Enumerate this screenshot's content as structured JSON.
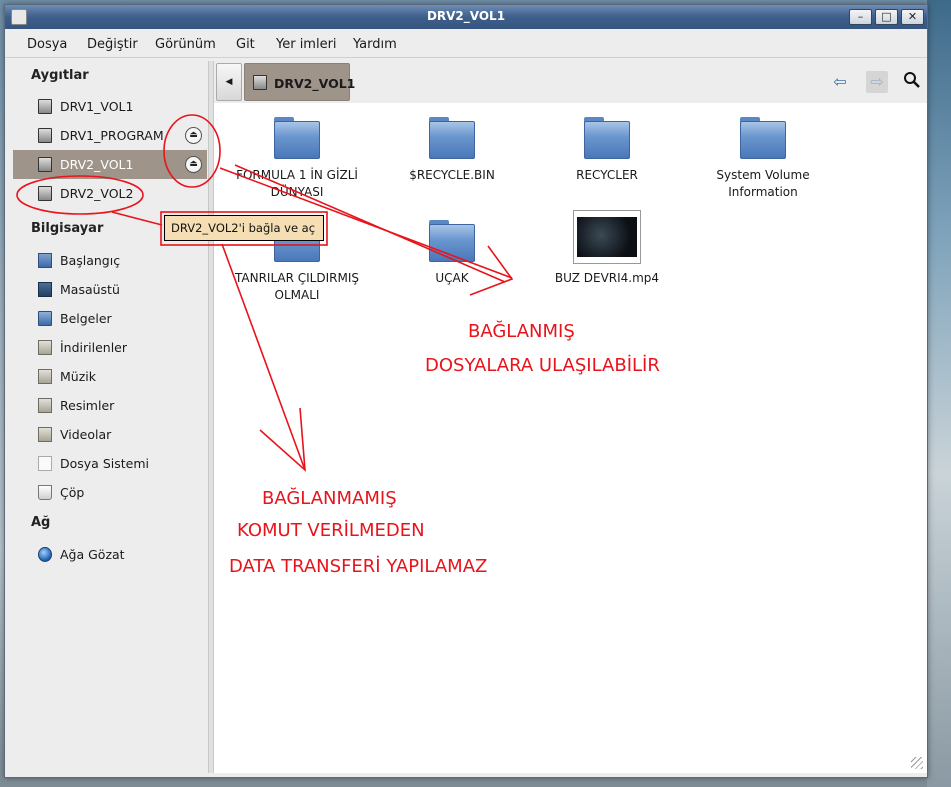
{
  "window": {
    "title": "DRV2_VOL1"
  },
  "menu": {
    "items": [
      {
        "label": "Dosya"
      },
      {
        "label": "Değiştir"
      },
      {
        "label": "Görünüm"
      },
      {
        "label": "Git"
      },
      {
        "label": "Yer imleri"
      },
      {
        "label": "Yardım"
      }
    ]
  },
  "sidebar": {
    "devices_heading": "Aygıtlar",
    "devices": [
      {
        "label": "DRV1_VOL1",
        "icon": "drive-icon",
        "eject": false,
        "selected": false
      },
      {
        "label": "DRV1_PROGRAM",
        "icon": "drive-icon",
        "eject": true,
        "selected": false
      },
      {
        "label": "DRV2_VOL1",
        "icon": "drive-icon",
        "eject": true,
        "selected": true
      },
      {
        "label": "DRV2_VOL2",
        "icon": "drive-icon",
        "eject": false,
        "selected": false
      }
    ],
    "computer_heading": "Bilgisayar",
    "computer": [
      {
        "label": "Başlangıç",
        "icon": "home-folder-icon"
      },
      {
        "label": "Masaüstü",
        "icon": "desktop-folder-icon"
      },
      {
        "label": "Belgeler",
        "icon": "documents-folder-icon"
      },
      {
        "label": "İndirilenler",
        "icon": "downloads-folder-icon"
      },
      {
        "label": "Müzik",
        "icon": "music-folder-icon"
      },
      {
        "label": "Resimler",
        "icon": "pictures-folder-icon"
      },
      {
        "label": "Videolar",
        "icon": "videos-folder-icon"
      },
      {
        "label": "Dosya Sistemi",
        "icon": "filesystem-icon"
      },
      {
        "label": "Çöp",
        "icon": "trash-icon"
      }
    ],
    "network_heading": "Ağ",
    "network": [
      {
        "label": "Ağa Gözat",
        "icon": "network-globe-icon"
      }
    ]
  },
  "pathbar": {
    "current": "DRV2_VOL1"
  },
  "files": [
    {
      "name": "FORMULA 1 İN GİZLİ DÜNYASI",
      "type": "folder"
    },
    {
      "name": "$RECYCLE.BIN",
      "type": "folder"
    },
    {
      "name": "RECYCLER",
      "type": "folder"
    },
    {
      "name": "System Volume Information",
      "type": "folder"
    },
    {
      "name": "TANRILAR ÇILDIRMIŞ OLMALI",
      "type": "folder"
    },
    {
      "name": "UÇAK",
      "type": "folder"
    },
    {
      "name": "BUZ DEVRI4.mp4",
      "type": "video"
    }
  ],
  "tooltip": {
    "text": "DRV2_VOL2'i bağla ve aç"
  },
  "annotations": {
    "mounted_line1": "BAĞLANMIŞ",
    "mounted_line2": "DOSYALARA ULAŞILABİLİR",
    "unmounted_line1": "BAĞLANMAMIŞ",
    "unmounted_line2": "KOMUT VERİLMEDEN",
    "unmounted_line3": "DATA TRANSFERİ YAPILAMAZ",
    "color": "#e8141c"
  },
  "colors": {
    "selection": "#9e9489",
    "titlebar": "#3f5f8c",
    "tooltip_bg": "#f5deb3"
  }
}
